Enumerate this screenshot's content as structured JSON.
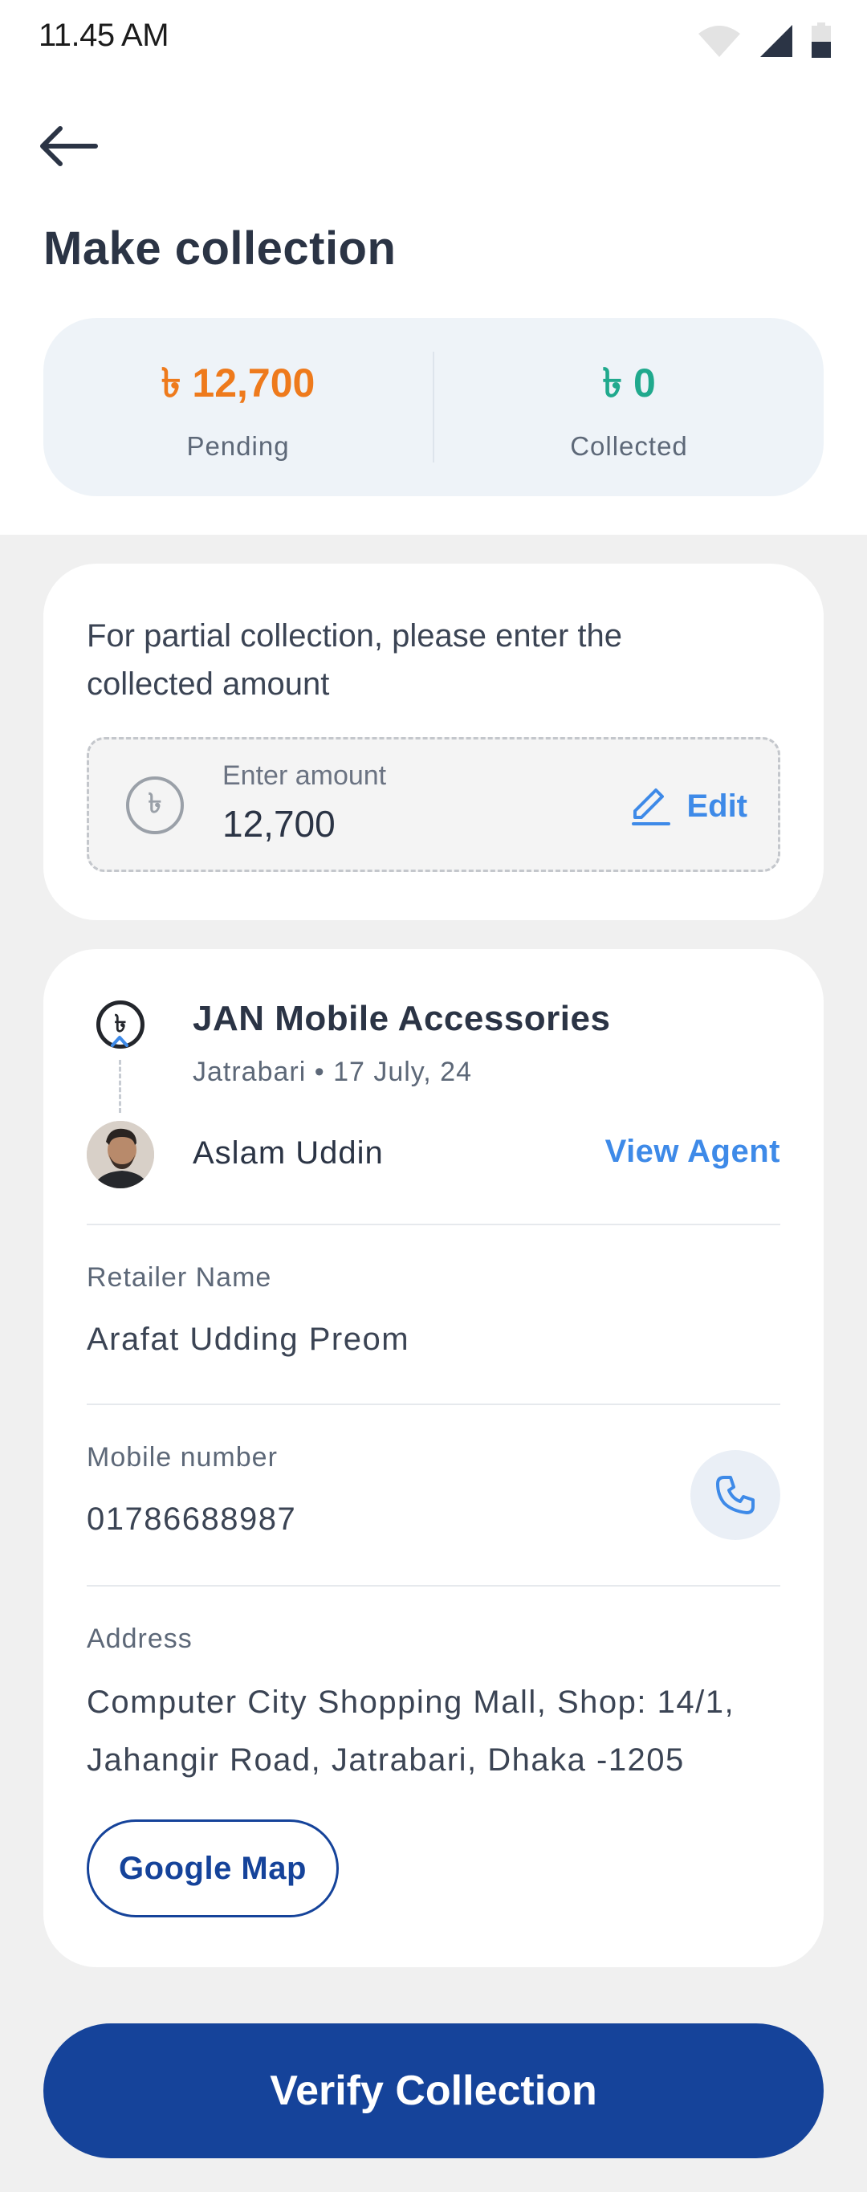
{
  "status_bar": {
    "time": "11.45 AM"
  },
  "header": {
    "title": "Make collection"
  },
  "summary": {
    "pending_amount": "৳ 12,700",
    "pending_label": "Pending",
    "collected_amount": "৳ 0",
    "collected_label": "Collected"
  },
  "partial": {
    "instruction": "For partial collection, please enter the collected amount",
    "input_placeholder": "Enter amount",
    "input_value": "12,700",
    "currency_symbol": "৳",
    "edit_label": "Edit"
  },
  "details": {
    "currency_symbol": "৳",
    "shop_name": "JAN Mobile Accessories",
    "shop_meta": "Jatrabari • 17 July, 24",
    "agent_name": "Aslam Uddin",
    "view_agent_label": "View Agent",
    "retailer_label": "Retailer Name",
    "retailer_value": "Arafat Udding Preom",
    "mobile_label": "Mobile number",
    "mobile_value": "01786688987",
    "address_label": "Address",
    "address_value": "Computer City Shopping Mall, Shop: 14/1, Jahangir Road, Jatrabari, Dhaka -1205",
    "map_label": "Google Map"
  },
  "footer": {
    "verify_label": "Verify Collection"
  },
  "colors": {
    "primary": "#15439a",
    "accent_blue": "#3e8ae8",
    "pending": "#ee7a1c",
    "collected": "#20a98d"
  },
  "icons": [
    "wifi-icon",
    "signal-icon",
    "battery-icon",
    "back-arrow-icon",
    "taka-icon",
    "edit-pencil-icon",
    "phone-icon"
  ]
}
